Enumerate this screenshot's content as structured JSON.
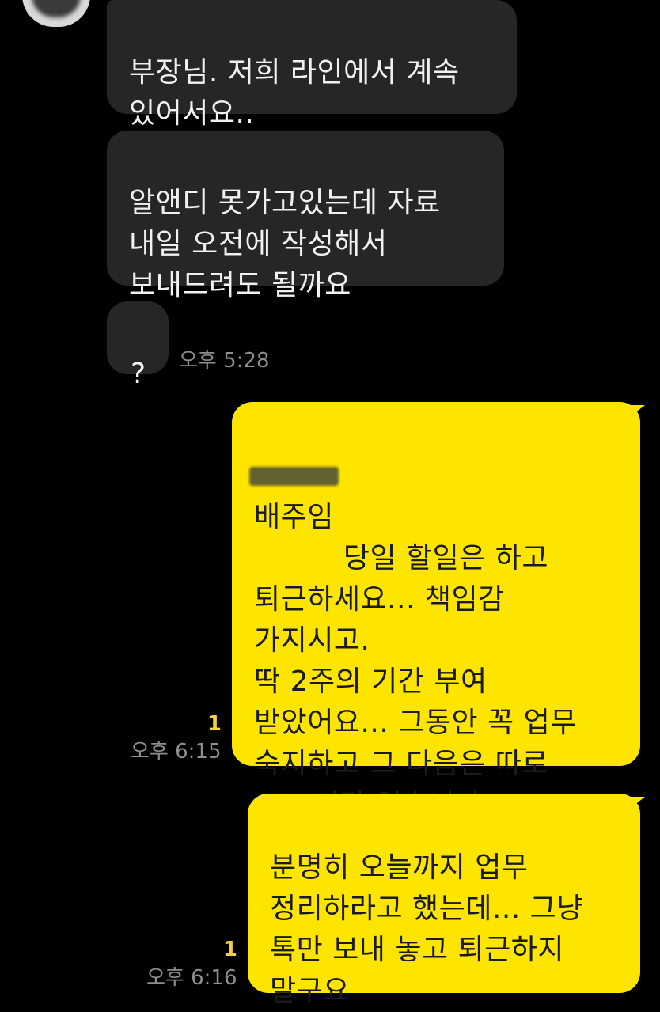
{
  "chat": {
    "incoming": [
      {
        "text": "부장님. 저희 라인에서 계속\n있어서요.."
      },
      {
        "text": "알앤디 못가고있는데 자료\n내일 오전에 작성해서\n보내드려도 될까요"
      },
      {
        "text": "?",
        "time": "오후 5:28"
      }
    ],
    "outgoing": [
      {
        "redacted_name": "배주임",
        "text": " 당일 할일은 하고\n퇴근하세요...  책임감\n가지시고.\n딱 2주의 기간 부여\n받았어요...  그동안 꼭 업무\n숙지하고 그 다음은 따로\nOJT 기간 없습니다..\n팀내에 적응하길 바랍니다.",
        "unread": "1",
        "time": "오후 6:15"
      },
      {
        "text": "분명히 오늘까지 업무\n정리하라고 했는데... 그냥\n톡만 보내 놓고 퇴근하지\n말구요",
        "unread": "1",
        "time": "오후 6:16"
      }
    ]
  },
  "colors": {
    "background": "#000000",
    "incoming_bubble": "#262626",
    "outgoing_bubble": "#fee500",
    "timestamp": "#8e8e8e",
    "unread_count": "#f3d23b"
  }
}
